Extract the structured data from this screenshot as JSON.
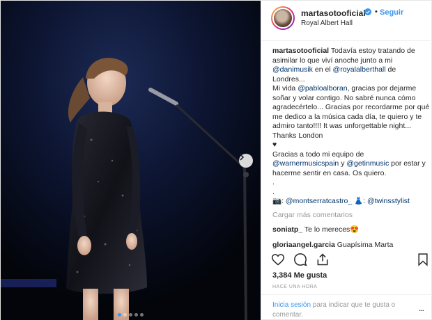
{
  "header": {
    "username": "martasotooficial",
    "follow_label": "Seguir",
    "separator": "•",
    "location": "Royal Albert Hall"
  },
  "caption": {
    "author": "martasotooficial",
    "text1": "Todavía estoy tratando de asimilar lo que viví anoche junto a mi ",
    "mention1": "@danimusik",
    "text2": " en el ",
    "mention2": "@royalalberthall",
    "text3": " de Londres...\nMi vida ",
    "mention3": "@pabloalboran",
    "text4": ", gracias por dejarme soñar y volar contigo. No sabré nunca cómo agradecértelo... Gracias por recordarme por qué me dedico a la música cada día, te quiero y te admiro tanto!!!! It was unforgettable night... Thanks London\n",
    "heart": "♥",
    "text5": "\nGracias a todo mi equipo de\n",
    "mention4": "@warnermusicspain",
    "text6": " y ",
    "mention5": "@getinmusic",
    "text7": " por estar y hacerme sentir en casa. Os quiero.\n.\n.\n",
    "camera_glyph": "📷",
    "text8": ": ",
    "mention6": "@montserratcastro_",
    "dress_glyph": "👗",
    "text9": ": ",
    "mention7": "@twinsstylist"
  },
  "load_more": "Cargar más comentarios",
  "replies": [
    {
      "user": "soniatp_",
      "text": "Te lo mereces😍"
    },
    {
      "user": "gloriaangel.garcia",
      "text": "Guapísima Marta"
    }
  ],
  "actions": {
    "like": "heart-outline-icon",
    "comment": "comment-icon",
    "share": "share-icon",
    "save": "bookmark-icon"
  },
  "likes": "3,384 Me gusta",
  "timestamp": "HACE UNA HORA",
  "footer": {
    "login_link": "Inicia sesión",
    "login_rest": " para indicar que te gusta o comentar.",
    "more": "..."
  },
  "carousel": {
    "dots_total": 5,
    "active_index": 0
  },
  "colors": {
    "accent": "#3897f0",
    "mention": "#003569",
    "muted": "#999999"
  }
}
